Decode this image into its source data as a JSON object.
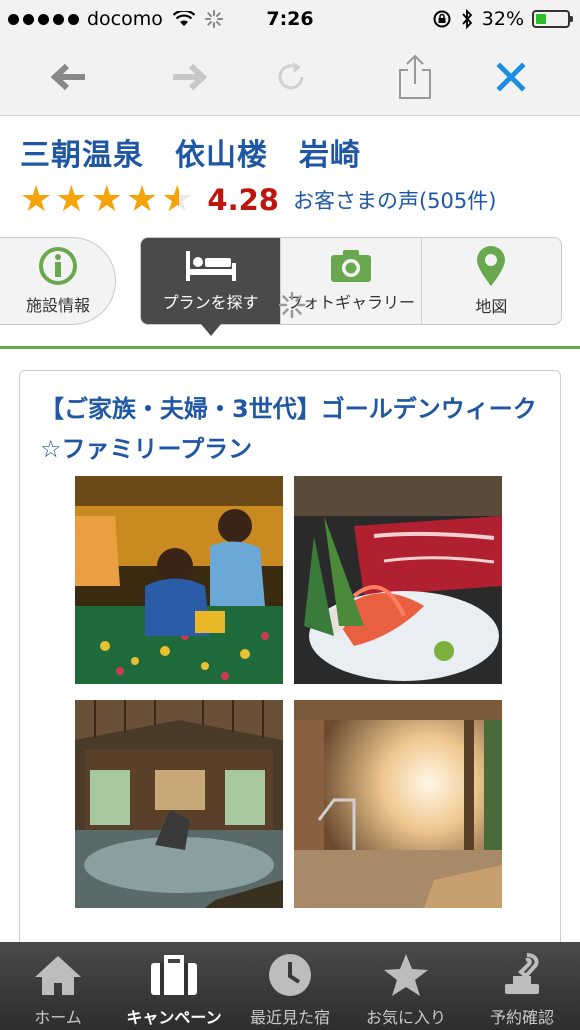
{
  "status_bar": {
    "carrier": "docomo",
    "time": "7:26",
    "battery_percent": "32%",
    "battery_level": 0.32
  },
  "browser_toolbar": {
    "buttons": [
      "back-arrow-icon",
      "forward-arrow-icon",
      "reload-icon",
      "share-icon",
      "close-icon"
    ]
  },
  "hotel": {
    "name": "三朝温泉　依山楼　岩崎",
    "rating_stars": 4.28,
    "score": "4.28",
    "reviews_link": "お客さまの声(505件)"
  },
  "tabs": [
    {
      "label": "施設情報",
      "icon": "info-icon"
    },
    {
      "label": "プランを探す",
      "icon": "bed-icon",
      "active": true
    },
    {
      "label": "フォトギャラリー",
      "icon": "camera-icon"
    },
    {
      "label": "地図",
      "icon": "map-pin-icon"
    }
  ],
  "plan": {
    "title": "【ご家族・夫婦・3世代】ゴールデンウィーク☆ファミリープラン",
    "photos": [
      "kids-festival-photo",
      "wagyu-sashimi-photo",
      "indoor-bath-photo",
      "bath-sunlight-photo"
    ]
  },
  "bottom_nav": [
    {
      "label": "ホーム",
      "icon": "home-icon"
    },
    {
      "label": "キャンペーン",
      "icon": "suitcase-icon",
      "active": true
    },
    {
      "label": "最近見た宿",
      "icon": "clock-icon"
    },
    {
      "label": "お気に入り",
      "icon": "star-icon"
    },
    {
      "label": "予約確認",
      "icon": "stamp-icon"
    }
  ],
  "colors": {
    "brand_blue": "#1f57a4",
    "score_red": "#c0140e",
    "star_orange": "#f5a30a",
    "icon_green": "#6aa84f",
    "toolbar_blue": "#1a8ee0"
  }
}
